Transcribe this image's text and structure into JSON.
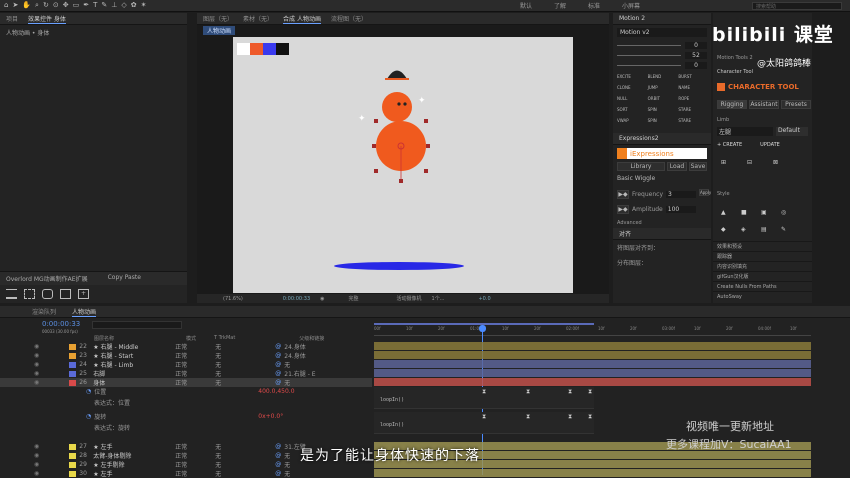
{
  "toolbar": {
    "icons": [
      "home-icon",
      "arrow-icon",
      "hand-icon",
      "zoom-icon",
      "rotate-icon",
      "camera-icon",
      "pan-icon",
      "rect-icon",
      "pen-icon",
      "text-icon",
      "brush-icon",
      "stamp-icon",
      "eraser-icon",
      "roto-icon",
      "pin-icon"
    ],
    "right_tabs": [
      "默认",
      "了解",
      "标准",
      "小屏幕"
    ],
    "search": "搜索帮助"
  },
  "left_panel": {
    "tabs": [
      "项目",
      "效果控件 身体"
    ],
    "crumb": "人物动画 • 身体",
    "tool_title": "Overlord MG动画制作AE扩展",
    "paste_tab": "Copy Paste"
  },
  "center_tabs": [
    "合成 人物动画",
    "图层（无）",
    "素材（无）",
    "流程图（无）"
  ],
  "comp_chip": "人物动画",
  "swatch_colors": [
    "#ffffff",
    "#ee5a2a",
    "#3a3aee",
    "#111111"
  ],
  "viewer_bar": {
    "zoom": "(71.6%)",
    "time": "0:00:00:33",
    "res": "完整",
    "camera": "活动摄像机",
    "views": "1个...",
    "offset": "+0.0"
  },
  "right_panel": {
    "motion_title": "Motion 2",
    "motion_ver": "Motion v2",
    "motion_fields": [
      "0",
      "52",
      "0"
    ],
    "motion_buttons": [
      "EXCITE",
      "BLEND",
      "BURST",
      "CLONE",
      "JUMP",
      "NAME",
      "NULL",
      "ORBIT",
      "ROPE",
      "SORT",
      "SPIN",
      "STARE",
      "VWAP",
      "SPIN",
      "STARE"
    ],
    "expr_title": "Expressions2",
    "expr_logo": "iExpressions",
    "expr_tabs": [
      "Library",
      "Load",
      "Save"
    ],
    "expr_item": "Basic Wiggle",
    "expr_apply": "Apply",
    "frequency_label": "Frequency",
    "frequency": "3",
    "amplitude_label": "Amplitude",
    "amplitude": "100",
    "advanced": "Advanced",
    "align_title": "对齐",
    "align_rows": [
      "将图层对齐到：",
      "分布图层："
    ],
    "ct_tabs": [
      "Motion Tools 2",
      "Character Tool"
    ],
    "ct_title": "CHARACTER TOOL",
    "ct_subtabs": [
      "Rigging",
      "Assistant",
      "Presets"
    ],
    "limb_label": "Limb",
    "limb_value": "左腿",
    "limb_default": "Default",
    "create": "+ CREATE",
    "update": "UPDATE",
    "style_label": "Style",
    "list": [
      "效果和预设",
      "跟踪器",
      "内容识别填充",
      "gifGun汉化版",
      "Create Nulls From Paths",
      "AutoSway"
    ]
  },
  "watermark": {
    "logo": "bilibili 课堂",
    "handle": "@太阳鸽鸽棒",
    "line1": "视频唯一更新地址",
    "line2": "更多课程加V：SucaiAA1"
  },
  "timeline": {
    "tabs": [
      "渲染队列",
      "人物动画"
    ],
    "time": "0:00:00:33",
    "frames": "00033 (30.00 fps)",
    "columns": [
      "图层名称",
      "模式",
      "T TrkMat",
      "父级和链接"
    ],
    "ticks": [
      "00f",
      "10f",
      "20f",
      "01:00f",
      "10f",
      "20f",
      "02:00f",
      "10f",
      "20f",
      "03:00f",
      "10f",
      "20f",
      "04:00f",
      "10f"
    ],
    "layers": [
      {
        "num": "22",
        "color": "#e8a132",
        "name": "★ 右腿 - Middle",
        "mode": "正常",
        "trk": "无",
        "parent": "24.身体",
        "bar": "#8a7a3a"
      },
      {
        "num": "23",
        "color": "#e8a132",
        "name": "★ 右腿 - Start",
        "mode": "正常",
        "trk": "无",
        "parent": "24.身体",
        "bar": "#8a7a3a"
      },
      {
        "num": "24",
        "color": "#5a6ad8",
        "name": "★ 右腿 - Limb",
        "mode": "正常",
        "trk": "无",
        "parent": "无",
        "bar": "#5c6498"
      },
      {
        "num": "25",
        "color": "#5a6ad8",
        "name": "右脚",
        "mode": "正常",
        "trk": "无",
        "parent": "21.右腿 - E",
        "bar": "#5c6498"
      },
      {
        "num": "26",
        "color": "#d84a4a",
        "name": "身体",
        "mode": "正常",
        "trk": "无",
        "parent": "无",
        "bar": "#c0504a"
      },
      {
        "num": "27",
        "color": "#e8d84a",
        "name": "★ 左手",
        "mode": "正常",
        "trk": "无",
        "parent": "31.左臂",
        "bar": "#9a9250"
      },
      {
        "num": "28",
        "color": "#e8d84a",
        "name": "太臂-身体剔除",
        "mode": "正常",
        "trk": "无",
        "parent": "无",
        "bar": "#9a9250"
      },
      {
        "num": "29",
        "color": "#e8d84a",
        "name": "★ 左手剔除",
        "mode": "正常",
        "trk": "无",
        "parent": "无",
        "bar": "#9a9250"
      },
      {
        "num": "30",
        "color": "#e8d84a",
        "name": "★ 左手",
        "mode": "正常",
        "trk": "无",
        "parent": "无",
        "bar": "#9a9250"
      }
    ],
    "props": [
      {
        "name": "位置",
        "value": "400.0,450.0",
        "expr": "表达式：位置",
        "code": "loopIn()"
      },
      {
        "name": "旋转",
        "value": "0x+0.0°",
        "expr": "表达式：旋转",
        "code": "loopIn()"
      }
    ]
  },
  "subtitle": "是为了能让身体快速的下落"
}
